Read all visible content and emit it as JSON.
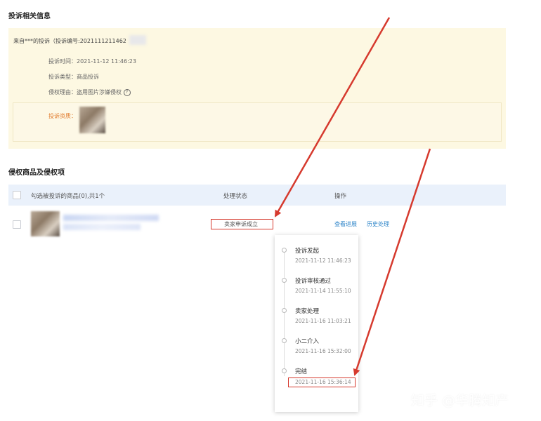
{
  "complaint_section": {
    "title": "投诉相关信息",
    "source_prefix": "来自***的投诉（投诉编号:",
    "complaint_number_visible": "2021111211462",
    "time_label": "投诉时间：",
    "time_value": "2021-11-12 11:46:23",
    "type_label": "投诉类型：",
    "type_value": "商品投诉",
    "reason_label": "侵权理由：",
    "reason_value": "盗用图片涉嫌侵权",
    "help_icon": "question-circle-icon",
    "evidence_label": "投诉资质："
  },
  "products_section": {
    "title": "侵权商品及侵权项",
    "columns": [
      "勾选被投诉的商品(0),共1个",
      "处理状态",
      "操作"
    ],
    "row": {
      "status": "卖家申诉成立",
      "actions": [
        "查看进展",
        "历史处理"
      ]
    }
  },
  "timeline": [
    {
      "title": "投诉发起",
      "time": "2021-11-12 11:46:23"
    },
    {
      "title": "投诉审核通过",
      "time": "2021-11-14 11:55:10"
    },
    {
      "title": "卖家处理",
      "time": "2021-11-16 11:03:21"
    },
    {
      "title": "小二介入",
      "time": "2021-11-16 15:32:00"
    },
    {
      "title": "完结",
      "time": "2021-11-16 15:36:14"
    }
  ],
  "watermark": "知乎 @华腾知产",
  "colors": {
    "highlight_red": "#d63a2e",
    "link_blue": "#2f86c9",
    "info_bg": "#fdf8e2",
    "header_bg": "#eaf1fb"
  }
}
